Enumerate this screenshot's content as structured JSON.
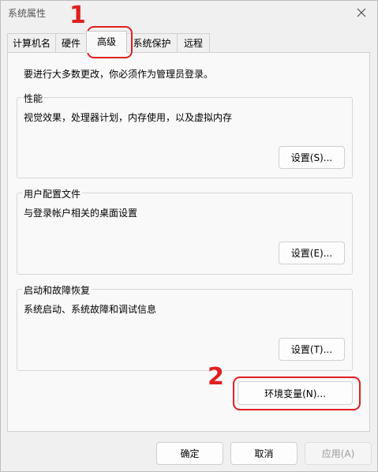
{
  "window": {
    "title": "系统属性"
  },
  "tabs": [
    {
      "label": "计算机名"
    },
    {
      "label": "硬件"
    },
    {
      "label": "高级",
      "active": true
    },
    {
      "label": "系统保护"
    },
    {
      "label": "远程"
    }
  ],
  "advanced": {
    "admin_notice": "要进行大多数更改，你必须作为管理员登录。",
    "performance": {
      "legend": "性能",
      "description": "视觉效果，处理器计划，内存使用，以及虚拟内存",
      "button": "设置(S)..."
    },
    "user_profiles": {
      "legend": "用户配置文件",
      "description": "与登录帐户相关的桌面设置",
      "button": "设置(E)..."
    },
    "startup_recovery": {
      "legend": "启动和故障恢复",
      "description": "系统启动、系统故障和调试信息",
      "button": "设置(T)..."
    },
    "env_button": "环境变量(N)..."
  },
  "footer": {
    "ok": "确定",
    "cancel": "取消",
    "apply": "应用(A)"
  },
  "annotations": {
    "step1": "1",
    "step2": "2",
    "color": "#e02020"
  }
}
